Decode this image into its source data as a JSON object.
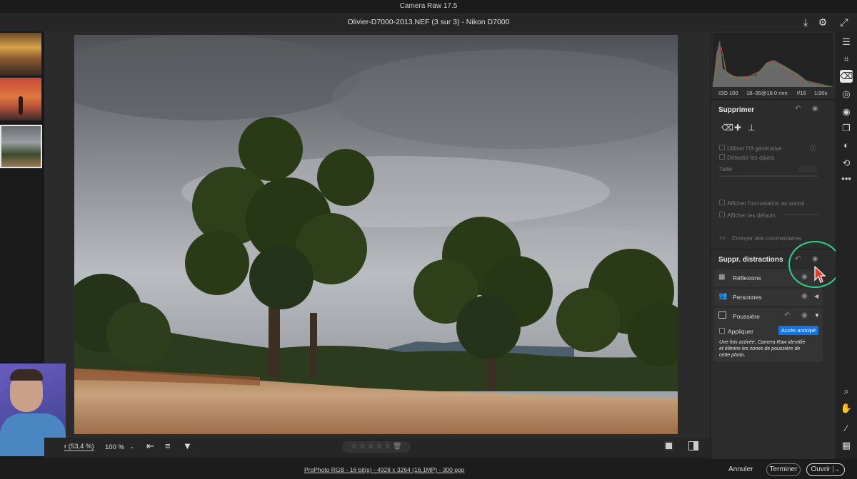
{
  "app": {
    "title": "Camera Raw 17.5"
  },
  "document": {
    "title": "Olivier-D7000-2013.NEF (3 sur 3)  -  Nikon D7000"
  },
  "toolbar_top": {
    "save_icon": "download-icon",
    "settings_icon": "gear-icon",
    "fullscreen_icon": "expand-icon"
  },
  "histogram_info": {
    "iso": "ISO 100",
    "focal": "18–35@18.0 mm",
    "aperture": "f/16",
    "shutter": "1/30s"
  },
  "remove_panel": {
    "title": "Supprimer",
    "use_ai": "Utiliser l'IA générative",
    "detect_objects": "Détecter les objets",
    "size_label": "Taille",
    "show_overlay": "Afficher l'incrustation au survol",
    "show_defects": "Afficher les défauts",
    "send_feedback": "Envoyer des commentaires"
  },
  "distractions_panel": {
    "title": "Suppr. distractions",
    "items": [
      {
        "label": "Réflexions"
      },
      {
        "label": "Personnes"
      },
      {
        "label": "Poussière"
      }
    ],
    "apply_label": "Appliquer",
    "early_access": "Accès anticipé",
    "description": "Une fois activée, Camera Raw identifie et élimine les zones de poussière de cette photo."
  },
  "bottom_tools": {
    "zoom_fit": "r (53,4 %)",
    "zoom_100": "100 %",
    "stars": "☆ ☆ ☆ ☆ ☆"
  },
  "status": {
    "info": "ProPhoto RGB - 16 bit(s) - 4928 x 3264 (16,1MP) - 300 ppp",
    "cancel": "Annuler",
    "done": "Terminer",
    "open": "Ouvrir"
  },
  "colors": {
    "accent": "#1473e6",
    "highlight_ring": "#2fd08a",
    "panel_bg": "#2c2c2c"
  }
}
